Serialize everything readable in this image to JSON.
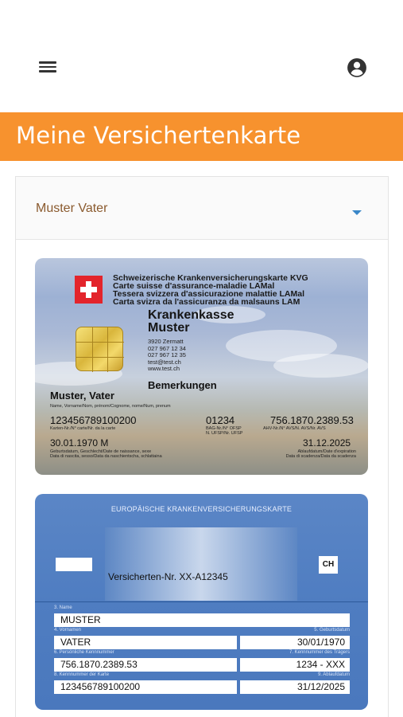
{
  "header": {
    "menu_icon": "hamburger-menu-icon",
    "account_icon": "account-circle-icon"
  },
  "page": {
    "title": "Meine Versichertenkarte",
    "accent_color": "#f7922e"
  },
  "insured": {
    "selected": "Muster Vater"
  },
  "swiss_card": {
    "header_lines": [
      "Schweizerische Krankenversicherungskarte KVG",
      "Carte suisse d'assurance-maladie LAMal",
      "Tessera svizzera d'assicurazione malattie LAMal",
      "Carta svizra da l'assicuranza da malsauns LAM"
    ],
    "insurer_line1": "Krankenkasse",
    "insurer_line2": "Muster",
    "address_lines": [
      "3920 Zermatt",
      "027 967 12 34",
      "027 967 12 35",
      "test@test.ch",
      "www.test.ch"
    ],
    "remarks_label": "Bemerkungen",
    "holder_name": "Muster, Vater",
    "holder_caption": "Name, Vorname/Nom, prénom/Cognome, nome/Num, prenum",
    "card_number": "123456789100200",
    "card_number_caption": "Karten-Nr./N° carte/Nr. da la carte",
    "bag_number": "01234",
    "bag_caption_1": "BAG-Nr./N° OFSP",
    "bag_caption_2": "N. UFSP/Nr. UFSP",
    "ahv_number": "756.1870.2389.53",
    "ahv_caption": "AHV-Nr./N° AVS/N. AVS/Nr. AVS",
    "birth": "30.01.1970 M",
    "birth_caption_1": "Geburtsdatum, Geschlecht/Date de naissance, sexe",
    "birth_caption_2": "Data di nascita, sesso/Data da naschientscha, schlattaina",
    "expiry": "31.12.2025",
    "expiry_caption_1": "Ablaufdatum/Date d'expiration",
    "expiry_caption_2": "Data di scadenza/Data da scadenza"
  },
  "eu_card": {
    "title": "EUROPÄISCHE KRANKENVERSICHERUNGSKARTE",
    "country": "CH",
    "insured_nr": "Versicherten-Nr.  XX-A12345",
    "label_name": "3. Name",
    "name": "MUSTER",
    "label_firstname": "4. Vornamen",
    "label_birth": "5. Geburtsdatum",
    "firstname": "VATER",
    "birth": "30/01/1970",
    "label_personal_nr": "6. Persönliche Kennnummer",
    "label_insurer_nr": "7. Kennnummer des Trägers",
    "personal_nr": "756.1870.2389.53",
    "insurer_nr": "1234 - XXX",
    "label_card_nr": "8. Kennnummer der Karte",
    "label_expiry": "9. Ablaufdatum",
    "card_nr": "123456789100200",
    "expiry": "31/12/2025"
  }
}
